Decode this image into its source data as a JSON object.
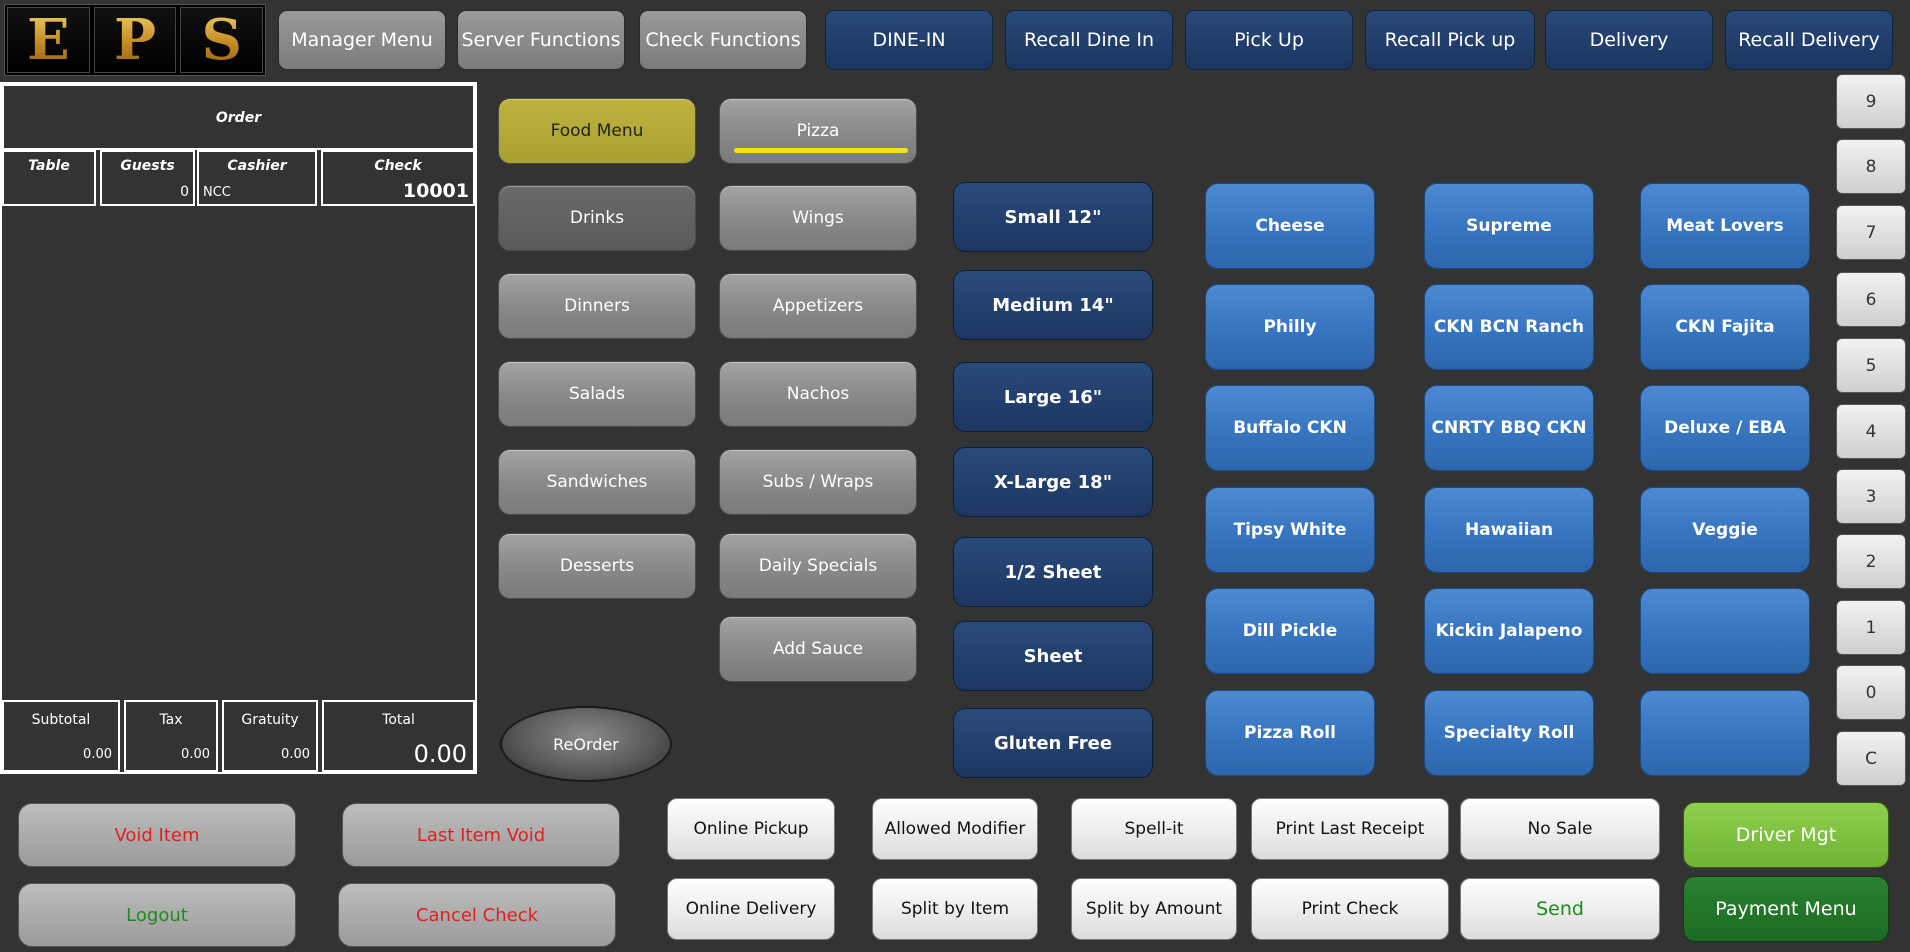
{
  "logo": {
    "letters": [
      "E",
      "P",
      "S"
    ]
  },
  "top_menu": {
    "grey": [
      "Manager Menu",
      "Server Functions",
      "Check Functions"
    ],
    "blue": [
      "DINE-IN",
      "Recall Dine In",
      "Pick Up",
      "Recall Pick up",
      "Delivery",
      "Recall Delivery"
    ]
  },
  "order": {
    "title": "Order",
    "table_label": "Table",
    "guests_label": "Guests",
    "guests_value": "0",
    "cashier_label": "Cashier",
    "cashier_value": "NCC",
    "check_label": "Check",
    "check_value": "10001",
    "subtotal_label": "Subtotal",
    "subtotal_value": "0.00",
    "tax_label": "Tax",
    "tax_value": "0.00",
    "gratuity_label": "Gratuity",
    "gratuity_value": "0.00",
    "total_label": "Total",
    "total_value": "0.00"
  },
  "categories": {
    "col1": [
      "Food Menu",
      "Drinks",
      "Dinners",
      "Salads",
      "Sandwiches",
      "Desserts"
    ],
    "col2": [
      "Pizza",
      "Wings",
      "Appetizers",
      "Nachos",
      "Subs / Wraps",
      "Daily Specials",
      "Add Sauce"
    ],
    "selected": "Pizza"
  },
  "reorder_label": "ReOrder",
  "sizes": [
    "Small 12\"",
    "Medium 14\"",
    "Large 16\"",
    "X-Large 18\"",
    "1/2 Sheet",
    "Sheet",
    "Gluten Free"
  ],
  "pizzas": [
    [
      "Cheese",
      "Supreme",
      "Meat Lovers"
    ],
    [
      "Philly",
      "CKN BCN Ranch",
      "CKN Fajita"
    ],
    [
      "Buffalo CKN",
      "CNRTY BBQ CKN",
      "Deluxe / EBA"
    ],
    [
      "Tipsy White",
      "Hawaiian",
      "Veggie"
    ],
    [
      "Dill Pickle",
      "Kickin Jalapeno",
      ""
    ],
    [
      "Pizza Roll",
      "Specialty Roll",
      ""
    ]
  ],
  "numpad": [
    "9",
    "8",
    "7",
    "6",
    "5",
    "4",
    "3",
    "2",
    "1",
    "0",
    "C"
  ],
  "bottom": {
    "void_item": "Void Item",
    "last_item_void": "Last Item Void",
    "logout": "Logout",
    "cancel_check": "Cancel Check",
    "online_pickup": "Online Pickup",
    "allowed_modifier": "Allowed Modifier",
    "spell_it": "Spell-it",
    "print_last_receipt": "Print Last Receipt",
    "no_sale": "No Sale",
    "driver_mgt": "Driver Mgt",
    "online_delivery": "Online Delivery",
    "split_by_item": "Split by Item",
    "split_by_amount": "Split by Amount",
    "print_check": "Print Check",
    "send": "Send",
    "payment_menu": "Payment Menu"
  },
  "colors": {
    "red_text": "#e02020",
    "green_text": "#1e8a1e",
    "food_menu": "#b3a935",
    "selected_underline": "#f3e21a",
    "driver_green": "#7fc041",
    "payment_green": "#1d6b23"
  }
}
